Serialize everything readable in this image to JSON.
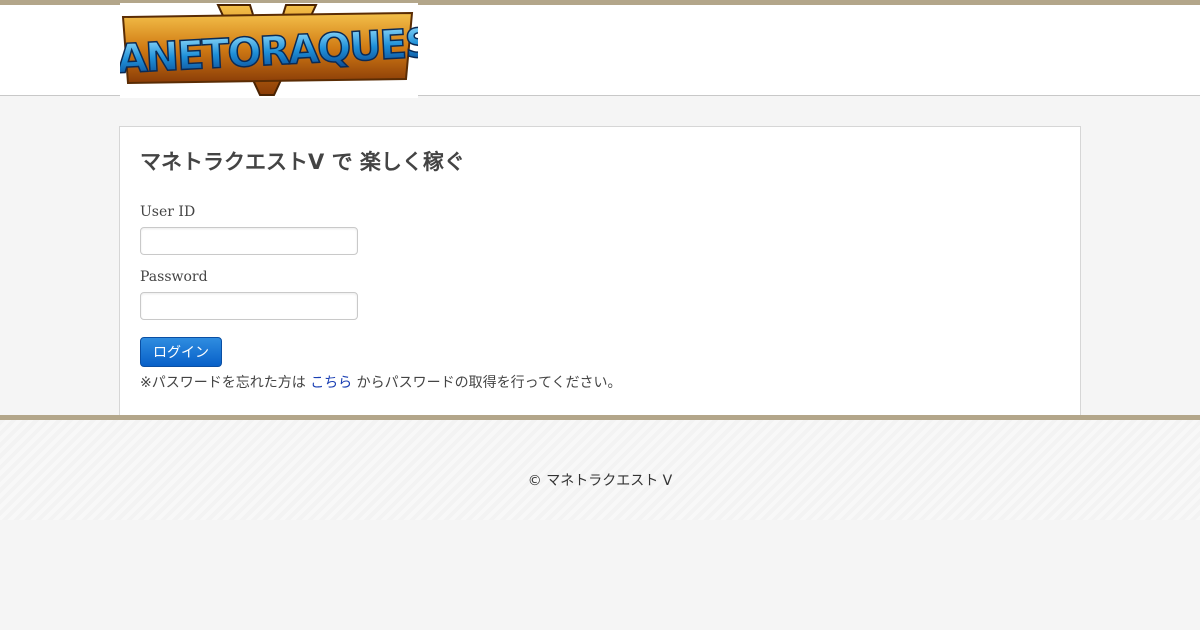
{
  "header": {
    "logo_text": "MANETORAQUEST",
    "logo_numeral": "V"
  },
  "login": {
    "title": "マネトラクエストV で 楽しく稼ぐ",
    "user_id_label": "User ID",
    "user_id_value": "",
    "password_label": "Password",
    "password_value": "",
    "login_button": "ログイン",
    "note_prefix": "※パスワードを忘れた方は",
    "note_link": "こちら",
    "note_suffix": "からパスワードの取得を行ってください。"
  },
  "footer": {
    "copyright": "© マネトラクエスト V"
  },
  "colors": {
    "accent_bar": "#b3a68a",
    "button": "#0860c8",
    "link": "#1a3fb3"
  }
}
